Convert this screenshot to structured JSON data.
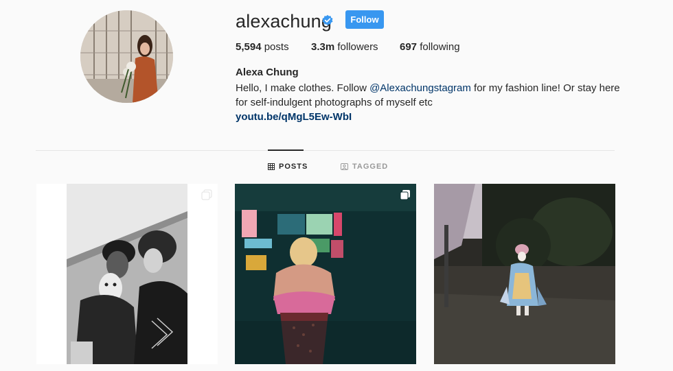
{
  "profile": {
    "username": "alexachung",
    "follow_label": "Follow",
    "verified_icon": "verified-badge-icon",
    "stats": {
      "posts_count": "5,594",
      "posts_label": "posts",
      "followers_count": "3.3m",
      "followers_label": "followers",
      "following_count": "697",
      "following_label": "following"
    },
    "full_name": "Alexa Chung",
    "bio": {
      "prefix": "Hello, I make clothes. Follow ",
      "mention": "@Alexachungstagram",
      "suffix": " for my fashion line! Or stay here for self-indulgent photographs of myself etc"
    },
    "link": "youtu.be/qMgL5Ew-WbI"
  },
  "tabs": [
    {
      "label": "POSTS",
      "icon": "grid-icon",
      "active": true
    },
    {
      "label": "TAGGED",
      "icon": "tagged-icon",
      "active": false
    }
  ],
  "colors": {
    "accent": "#3897f0",
    "link": "#003569",
    "background": "#fafafa"
  },
  "posts": [
    {
      "description_icon": "multiple-photos-icon"
    },
    {
      "description_icon": "multiple-photos-icon"
    },
    {
      "description_icon": ""
    }
  ]
}
